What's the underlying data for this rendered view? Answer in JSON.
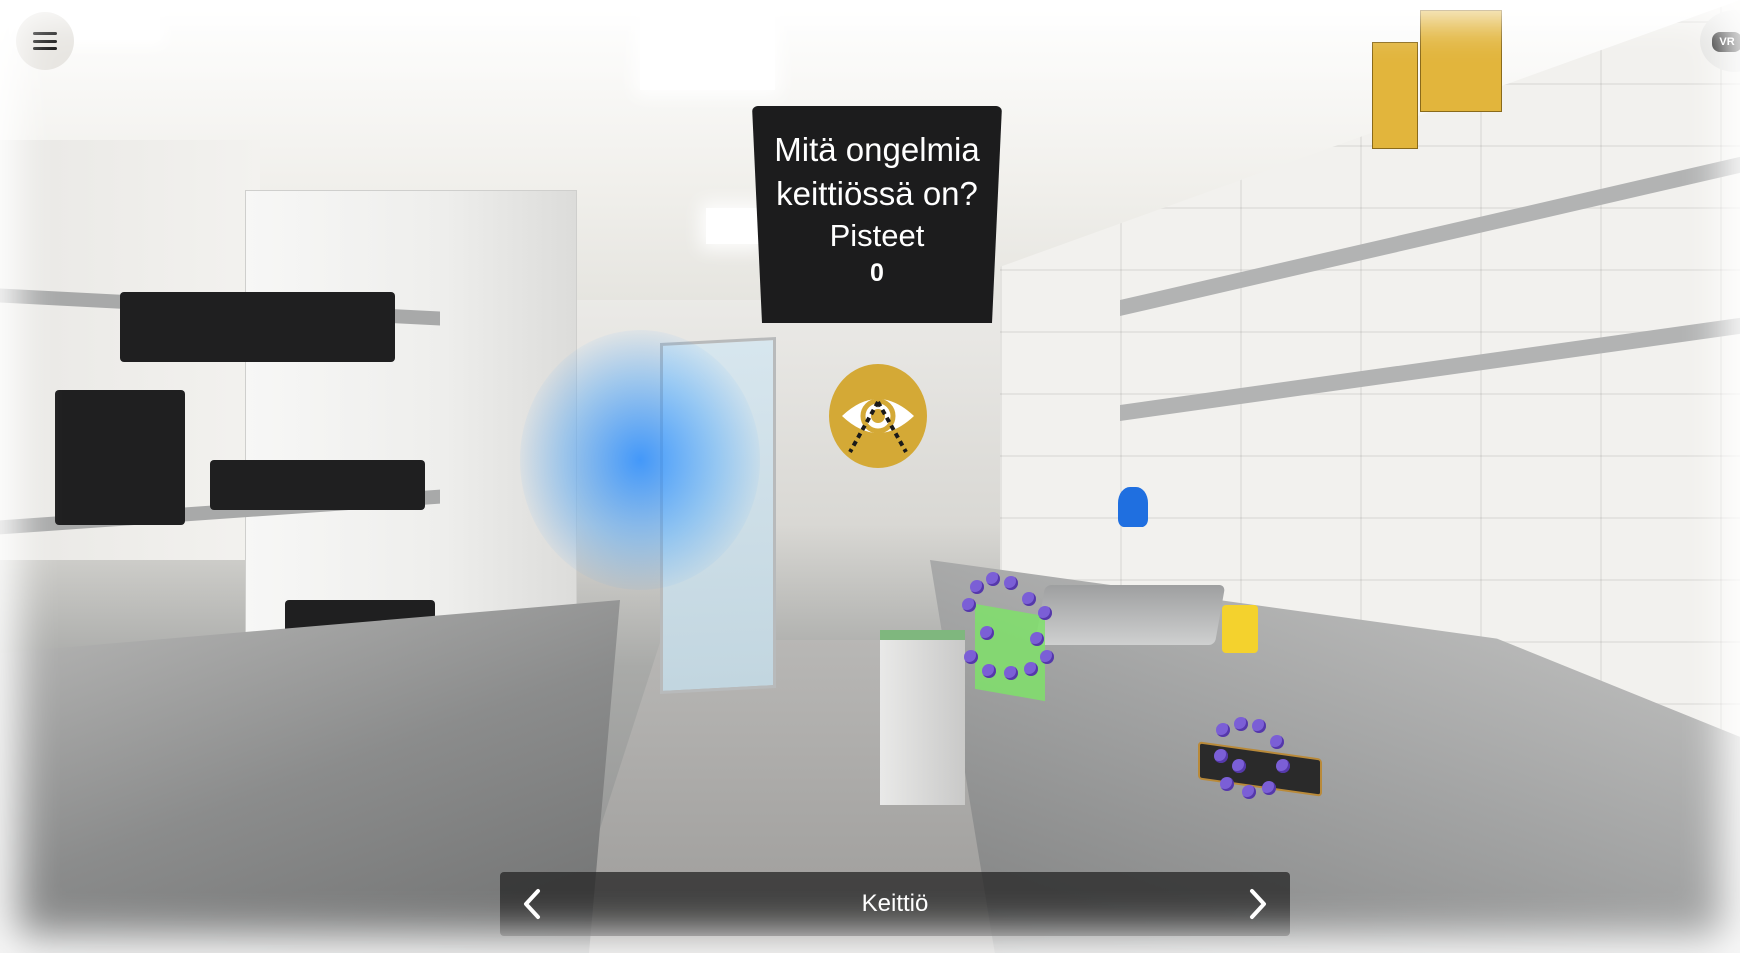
{
  "question_panel": {
    "title_line1": "Mitä ongelmia",
    "title_line2": "keittiössä on?",
    "score_label": "Pisteet",
    "score_value": "0"
  },
  "navigation": {
    "scene_label": "Keittiö",
    "prev_icon": "chevron-left-icon",
    "next_icon": "chevron-right-icon"
  },
  "menu": {
    "icon": "hamburger-menu-icon"
  },
  "vr": {
    "label": "VR",
    "icon": "vr-headset-icon"
  },
  "hotspots": {
    "info_icon": "eye-icon",
    "germ_icon": "germ-cluster-icon"
  },
  "colors": {
    "panel_bg": "#1c1c1d",
    "hotspot_gold": "#d4a936",
    "germ_purple": "#7b5fd6",
    "nav_bar_bg": "rgba(40,40,40,0.78)"
  }
}
